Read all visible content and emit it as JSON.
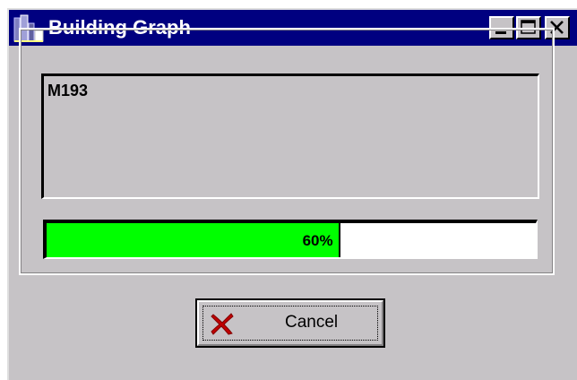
{
  "window": {
    "title": "Building Graph",
    "title_bar_color": "#000080",
    "background_color": "#c6c3c6",
    "icons": {
      "app": "building-graph-icon",
      "minimize": "minimize-icon",
      "maximize": "maximize-icon",
      "close": "close-icon"
    }
  },
  "status": {
    "message": "M193"
  },
  "progress": {
    "percent": 60,
    "label": "60%",
    "fill_color": "#00ff00"
  },
  "actions": {
    "cancel_label": "Cancel",
    "cancel_icon": "red-x-icon"
  }
}
